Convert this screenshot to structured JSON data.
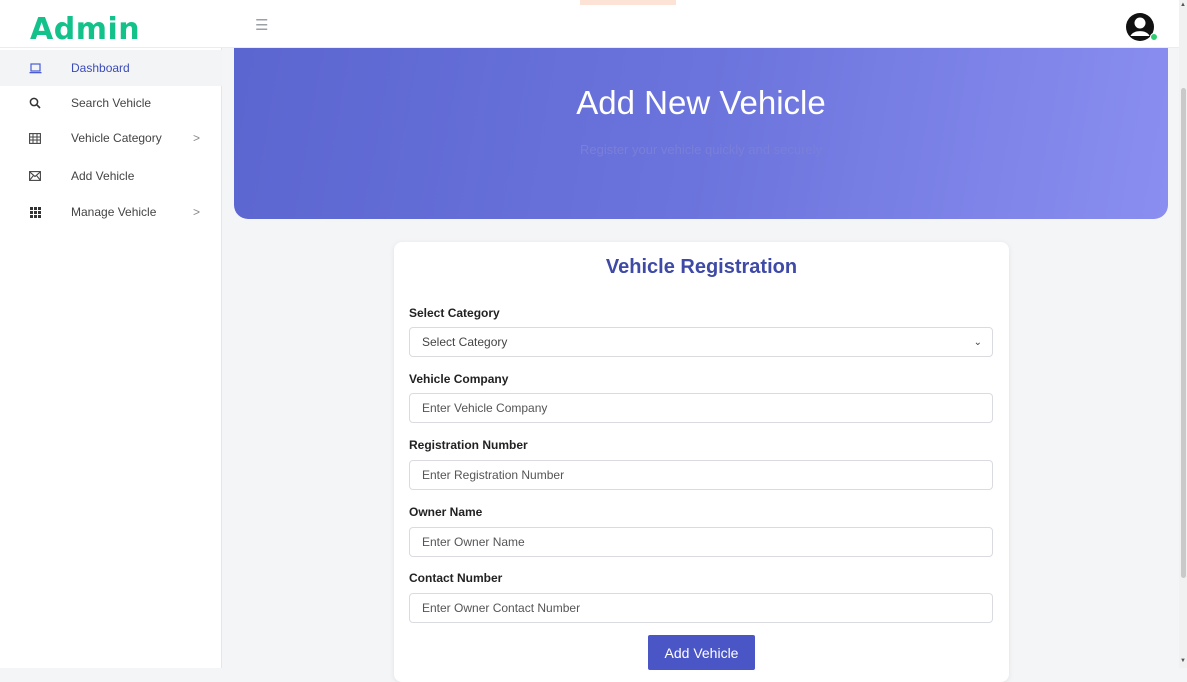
{
  "brand": {
    "name": "Admin",
    "color": "#13c28b"
  },
  "topbar": {
    "menu_icon": "hamburger-icon",
    "avatar_icon": "user-avatar-icon"
  },
  "sidebar": {
    "items": [
      {
        "label": "Dashboard",
        "icon": "laptop-icon",
        "active": true,
        "has_submenu": false
      },
      {
        "label": "Search Vehicle",
        "icon": "search-icon",
        "active": false,
        "has_submenu": false
      },
      {
        "label": "Vehicle Category",
        "icon": "table-icon",
        "active": false,
        "has_submenu": true
      },
      {
        "label": "Add Vehicle",
        "icon": "mail-icon",
        "active": false,
        "has_submenu": false
      },
      {
        "label": "Manage Vehicle",
        "icon": "grid-icon",
        "active": false,
        "has_submenu": true
      }
    ]
  },
  "hero": {
    "title": "Add New Vehicle",
    "subtitle": "Register your vehicle quickly and securely"
  },
  "form": {
    "title": "Vehicle Registration",
    "category": {
      "label": "Select Category",
      "value": "Select Category"
    },
    "company": {
      "label": "Vehicle Company",
      "placeholder": "Enter Vehicle Company"
    },
    "registration": {
      "label": "Registration Number",
      "placeholder": "Enter Registration Number"
    },
    "owner": {
      "label": "Owner Name",
      "placeholder": "Enter Owner Name"
    },
    "contact": {
      "label": "Contact Number",
      "placeholder": "Enter Owner Contact Number"
    },
    "submit_label": "Add Vehicle"
  },
  "colors": {
    "accent": "#4a55c6",
    "hero_start": "#5c66d0",
    "hero_end": "#8a8ef0",
    "online": "#2ecc71"
  }
}
